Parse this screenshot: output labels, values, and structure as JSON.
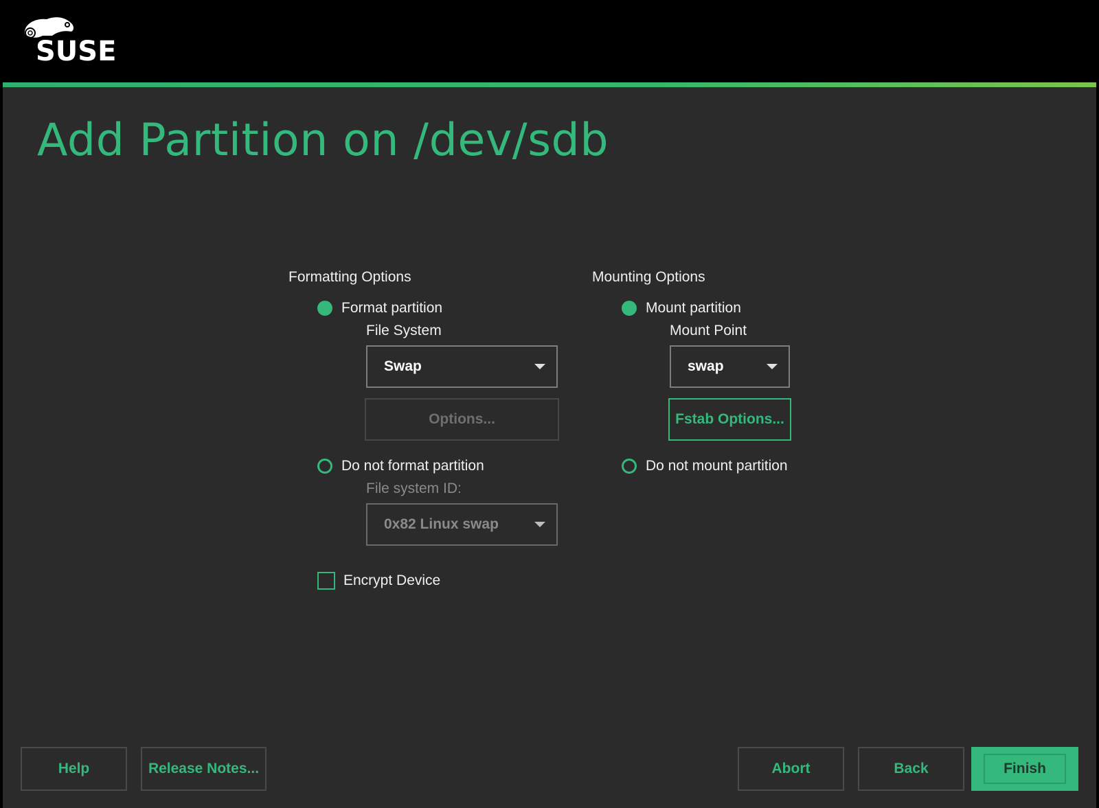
{
  "brand": {
    "logo_text": "SUSE",
    "accent_color": "#34b87c"
  },
  "page": {
    "title": "Add Partition on /dev/sdb"
  },
  "formatting": {
    "section_title": "Formatting Options",
    "format_partition_label": "Format partition",
    "file_system_label": "File System",
    "file_system_value": "Swap",
    "options_button": "Options...",
    "do_not_format_label": "Do not format partition",
    "file_system_id_label": "File system ID:",
    "file_system_id_value": "0x82 Linux swap",
    "encrypt_label": "Encrypt Device"
  },
  "mounting": {
    "section_title": "Mounting Options",
    "mount_partition_label": "Mount partition",
    "mount_point_label": "Mount Point",
    "mount_point_value": "swap",
    "fstab_button": "Fstab Options...",
    "do_not_mount_label": "Do not mount partition"
  },
  "footer": {
    "help": "Help",
    "release_notes": "Release Notes...",
    "abort": "Abort",
    "back": "Back",
    "finish": "Finish"
  }
}
